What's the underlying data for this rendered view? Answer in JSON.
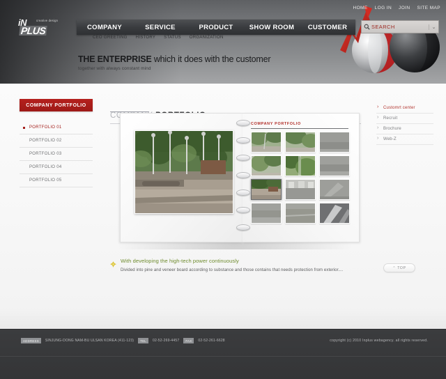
{
  "site": {
    "logo_text": "iN",
    "logo_accent": "PLUS",
    "logo_tagline": "creative design"
  },
  "topnav": {
    "items": [
      {
        "label": "HOME"
      },
      {
        "label": "LOG IN"
      },
      {
        "label": "JOIN"
      },
      {
        "label": "SITE MAP"
      }
    ]
  },
  "mainnav": {
    "items": [
      {
        "label": "COMPANY"
      },
      {
        "label": "SERVICE"
      },
      {
        "label": "PRODUCT"
      },
      {
        "label": "SHOW ROOM"
      },
      {
        "label": "CUSTOMER"
      }
    ]
  },
  "search": {
    "label": "SEARCH",
    "icon": "magnifier-icon",
    "caret": "⌄"
  },
  "subnav": {
    "items": [
      {
        "label": "CEO GREETING"
      },
      {
        "label": "HISTORY"
      },
      {
        "label": "STATUS"
      },
      {
        "label": "ORGANIZATION"
      }
    ]
  },
  "hero": {
    "title_bold": "THE ENTERPRISE",
    "title_rest": " which it does with the customer",
    "subtitle": "together with always constant mind"
  },
  "left_sidebar": {
    "header": "COMPANY PORTFOLIO",
    "items": [
      {
        "label": "PORTFOLIO 01",
        "active": true
      },
      {
        "label": "PORTFOLIO 02",
        "active": false
      },
      {
        "label": "PORTFOLIO 03",
        "active": false
      },
      {
        "label": "PORTFOLIO 04",
        "active": false
      },
      {
        "label": "PORTFOLIO 05",
        "active": false
      }
    ]
  },
  "content": {
    "heading_light": "COMPANY",
    "heading_bold": "PORTFOLIO",
    "book": {
      "right_page_title": "COMPANY PORTFOLIO",
      "thumbnail_count": 12,
      "selected_thumbnail_index": 6
    },
    "description": {
      "icon": "leaf-bullet-icon",
      "title": "With developing the high-tech power continuously",
      "body": "Divided into pine and veneer board according to substance and those contains that needs protection from exterior...."
    }
  },
  "right_sidebar": {
    "items": [
      {
        "label": "Customrt center",
        "active": true
      },
      {
        "label": "Recruit",
        "active": false
      },
      {
        "label": "Brochure",
        "active": false
      },
      {
        "label": "Web-Z",
        "active": false
      }
    ],
    "top_button": "⌃ TOP"
  },
  "footer": {
    "address_tag": "ADDRESS",
    "address": "SINJUNG-DONG NAM-BU ULSAN KOREA  (411-123)",
    "tel_tag": "TEL",
    "tel": "02-52-269-4457",
    "fax_tag": "FAX",
    "fax": "02-52-261-6628",
    "copyright": "copyright (c) 2010 Inplus webagency.  all rights reserved."
  },
  "colors": {
    "brand_red": "#a4201c",
    "nav_dark": "#3a3c3f",
    "accent_green": "#6e8b2d",
    "footer_bg": "#3b3c3e"
  }
}
